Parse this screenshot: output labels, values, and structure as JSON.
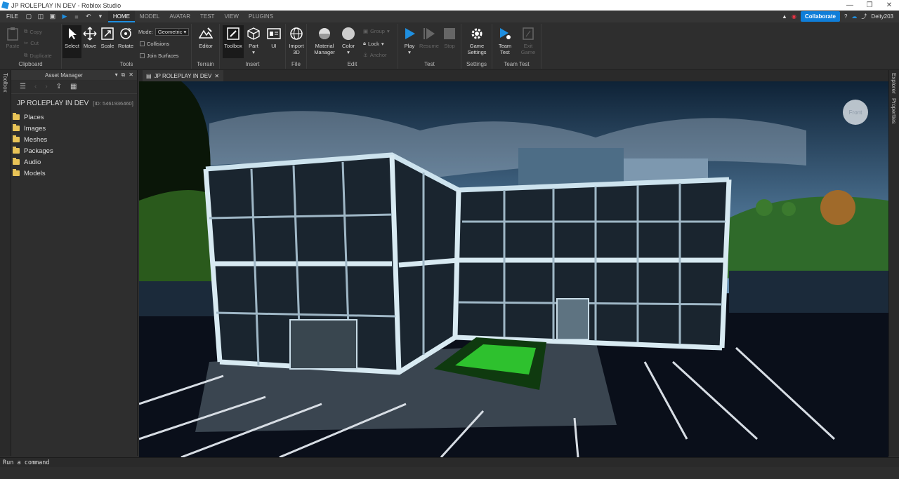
{
  "window": {
    "title": "JP ROLEPLAY IN DEV - Roblox Studio"
  },
  "menubar": {
    "file": "FILE",
    "tabs": [
      "HOME",
      "MODEL",
      "AVATAR",
      "TEST",
      "VIEW",
      "PLUGINS"
    ],
    "collaborate": "Collaborate",
    "user": "Deity203"
  },
  "ribbon": {
    "clipboard": {
      "paste": "Paste",
      "copy": "Copy",
      "cut": "Cut",
      "duplicate": "Duplicate",
      "label": "Clipboard"
    },
    "tools": {
      "select": "Select",
      "move": "Move",
      "scale": "Scale",
      "rotate": "Rotate",
      "mode_label": "Mode:",
      "mode_value": "Geometric",
      "collisions": "Collisions",
      "join_surfaces": "Join Surfaces",
      "label": "Tools"
    },
    "terrain": {
      "editor": "Editor",
      "label": "Terrain"
    },
    "insert": {
      "toolbox": "Toolbox",
      "part": "Part",
      "ui": "UI",
      "label": "Insert"
    },
    "file": {
      "import3d_1": "Import",
      "import3d_2": "3D",
      "label": "File"
    },
    "edit": {
      "material1": "Material",
      "material2": "Manager",
      "color": "Color",
      "group": "Group",
      "lock": "Lock",
      "anchor": "Anchor",
      "label": "Edit"
    },
    "test": {
      "play": "Play",
      "resume": "Resume",
      "stop": "Stop",
      "label": "Test"
    },
    "settings": {
      "gs1": "Game",
      "gs2": "Settings",
      "label": "Settings"
    },
    "teamtest": {
      "tt1": "Team",
      "tt2": "Test",
      "eg1": "Exit",
      "eg2": "Game",
      "label": "Team Test"
    }
  },
  "side": {
    "toolbox": "Toolbox",
    "explorer": "Explorer",
    "properties": "Properties"
  },
  "asset_manager": {
    "title": "Asset Manager",
    "game_name": "JP ROLEPLAY IN DEV",
    "game_id": "[ID: 5461936460]",
    "items": [
      "Places",
      "Images",
      "Meshes",
      "Packages",
      "Audio",
      "Models"
    ]
  },
  "doc_tab": {
    "label": "JP ROLEPLAY IN DEV"
  },
  "viewport": {
    "view_cube": "Front"
  },
  "command_bar": {
    "placeholder": "Run a command"
  }
}
